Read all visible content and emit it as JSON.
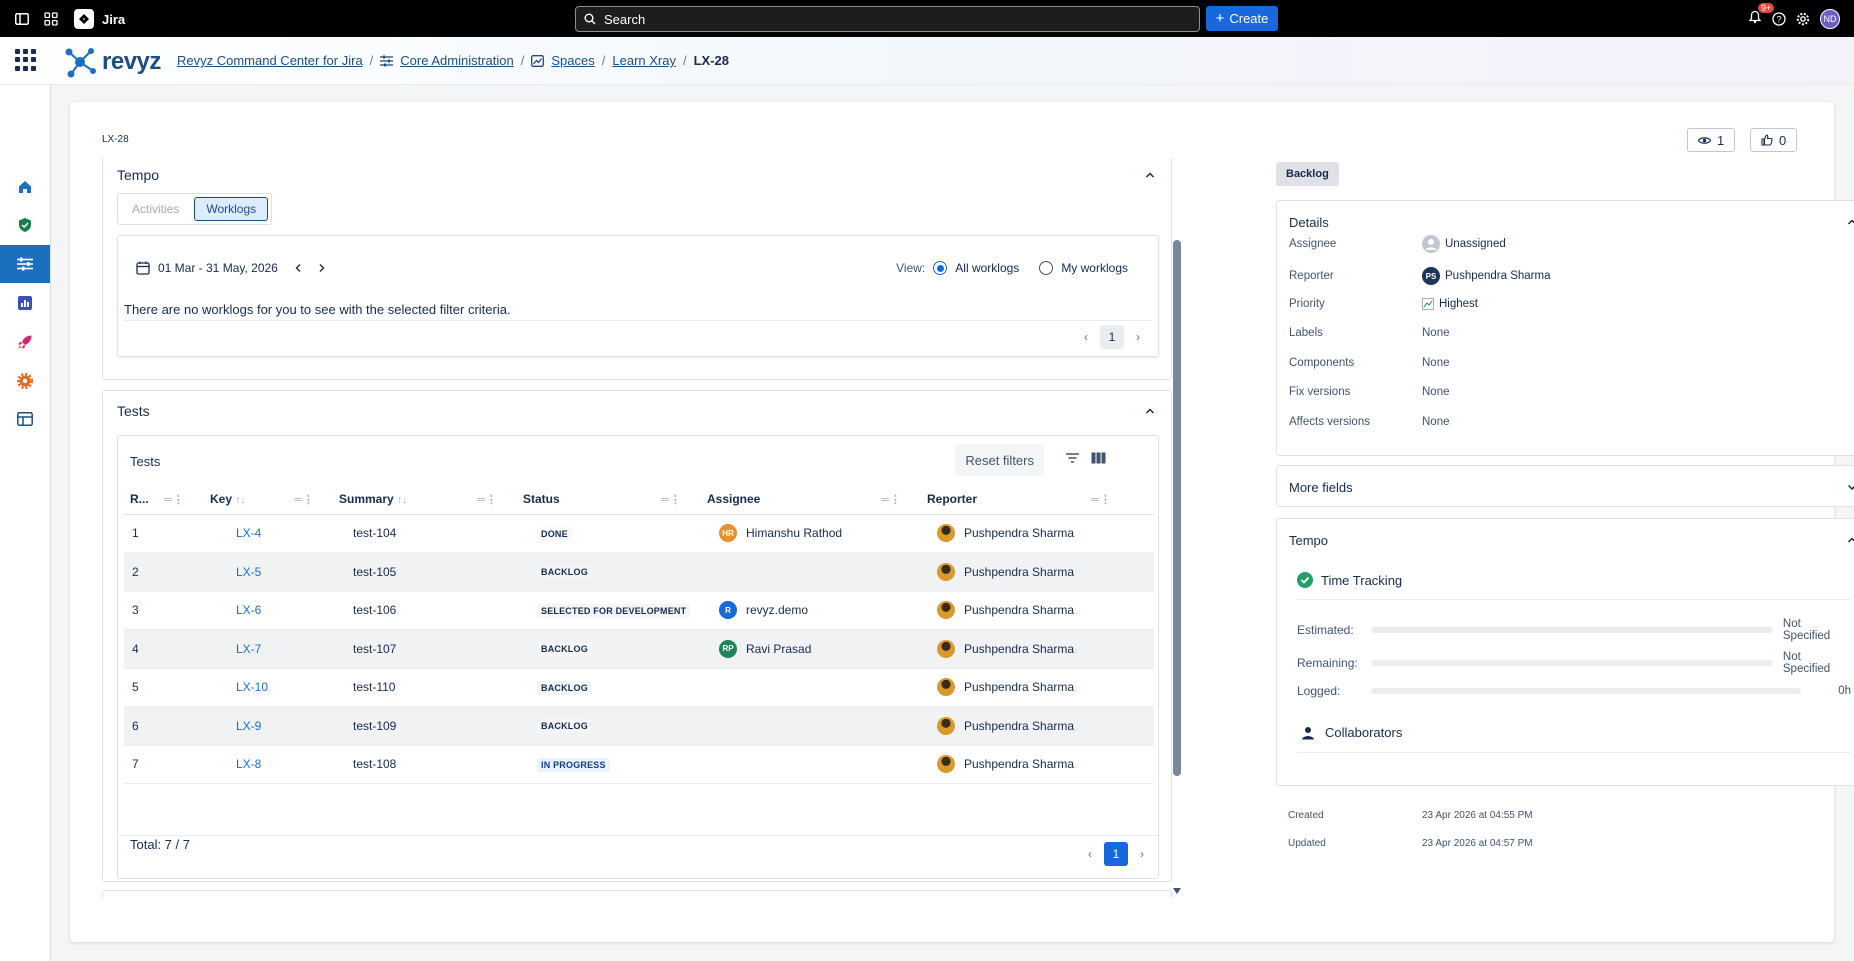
{
  "topbar": {
    "app_name": "Jira",
    "search_placeholder": "Search",
    "create_label": "Create",
    "notifications_count": "9+",
    "avatar_initials": "ND"
  },
  "header": {
    "brand": "revyz",
    "breadcrumb": {
      "b1": "Revyz Command Center for Jira",
      "b2": "Core Administration",
      "b3": "Spaces",
      "b4": "Learn Xray",
      "current": "LX-28"
    }
  },
  "issue": {
    "key": "LX-28",
    "watchers": "1",
    "votes": "0",
    "status_button": "Backlog"
  },
  "tempo": {
    "title": "Tempo",
    "tabs": [
      "Activities",
      "Worklogs"
    ],
    "date_range": "01 Mar - 31 May, 2026",
    "view_label": "View:",
    "view_all": "All worklogs",
    "view_mine": "My worklogs",
    "empty_message": "There are no worklogs for you to see with the selected filter criteria.",
    "page": "1"
  },
  "tests": {
    "section_title": "Tests",
    "table_title": "Tests",
    "reset_filters": "Reset filters",
    "columns": [
      "R...",
      "Key",
      "Summary",
      "Status",
      "Assignee",
      "Reporter"
    ],
    "rows": [
      {
        "rank": "1",
        "key": "LX-4",
        "summary": "test-104",
        "status": "DONE",
        "assignee": "Himanshu Rathod",
        "assignee_initials": "HR",
        "reporter": "Pushpendra Sharma"
      },
      {
        "rank": "2",
        "key": "LX-5",
        "summary": "test-105",
        "status": "BACKLOG",
        "assignee": "",
        "assignee_initials": "",
        "reporter": "Pushpendra Sharma"
      },
      {
        "rank": "3",
        "key": "LX-6",
        "summary": "test-106",
        "status": "SELECTED FOR DEVELOPMENT",
        "assignee": "revyz.demo",
        "assignee_initials": "R",
        "reporter": "Pushpendra Sharma"
      },
      {
        "rank": "4",
        "key": "LX-7",
        "summary": "test-107",
        "status": "BACKLOG",
        "assignee": "Ravi Prasad",
        "assignee_initials": "RP",
        "reporter": "Pushpendra Sharma"
      },
      {
        "rank": "5",
        "key": "LX-10",
        "summary": "test-110",
        "status": "BACKLOG",
        "assignee": "",
        "assignee_initials": "",
        "reporter": "Pushpendra Sharma"
      },
      {
        "rank": "6",
        "key": "LX-9",
        "summary": "test-109",
        "status": "BACKLOG",
        "assignee": "",
        "assignee_initials": "",
        "reporter": "Pushpendra Sharma"
      },
      {
        "rank": "7",
        "key": "LX-8",
        "summary": "test-108",
        "status": "IN PROGRESS",
        "assignee": "",
        "assignee_initials": "",
        "reporter": "Pushpendra Sharma"
      }
    ],
    "total": "Total: 7 / 7",
    "page": "1"
  },
  "details": {
    "title": "Details",
    "fields": [
      {
        "label": "Assignee",
        "value": "Unassigned"
      },
      {
        "label": "Reporter",
        "value": "Pushpendra Sharma",
        "initials": "PS"
      },
      {
        "label": "Priority",
        "value": "Highest"
      },
      {
        "label": "Labels",
        "value": "None"
      },
      {
        "label": "Components",
        "value": "None"
      },
      {
        "label": "Fix versions",
        "value": "None"
      },
      {
        "label": "Affects versions",
        "value": "None"
      }
    ]
  },
  "more_fields": {
    "title": "More fields"
  },
  "tempo_panel": {
    "title": "Tempo",
    "time_tracking": "Time Tracking",
    "estimated_label": "Estimated:",
    "estimated_value": "Not Specified",
    "remaining_label": "Remaining:",
    "remaining_value": "Not Specified",
    "logged_label": "Logged:",
    "logged_value": "0h",
    "collaborators": "Collaborators"
  },
  "meta": {
    "created_label": "Created",
    "created_value": "23 Apr 2026 at 04:55 PM",
    "updated_label": "Updated",
    "updated_value": "23 Apr 2026 at 04:57 PM"
  },
  "colors": {
    "accent": "#1868db",
    "sidebar_active": "#1c6fbf",
    "brand": "#1c4e80"
  }
}
